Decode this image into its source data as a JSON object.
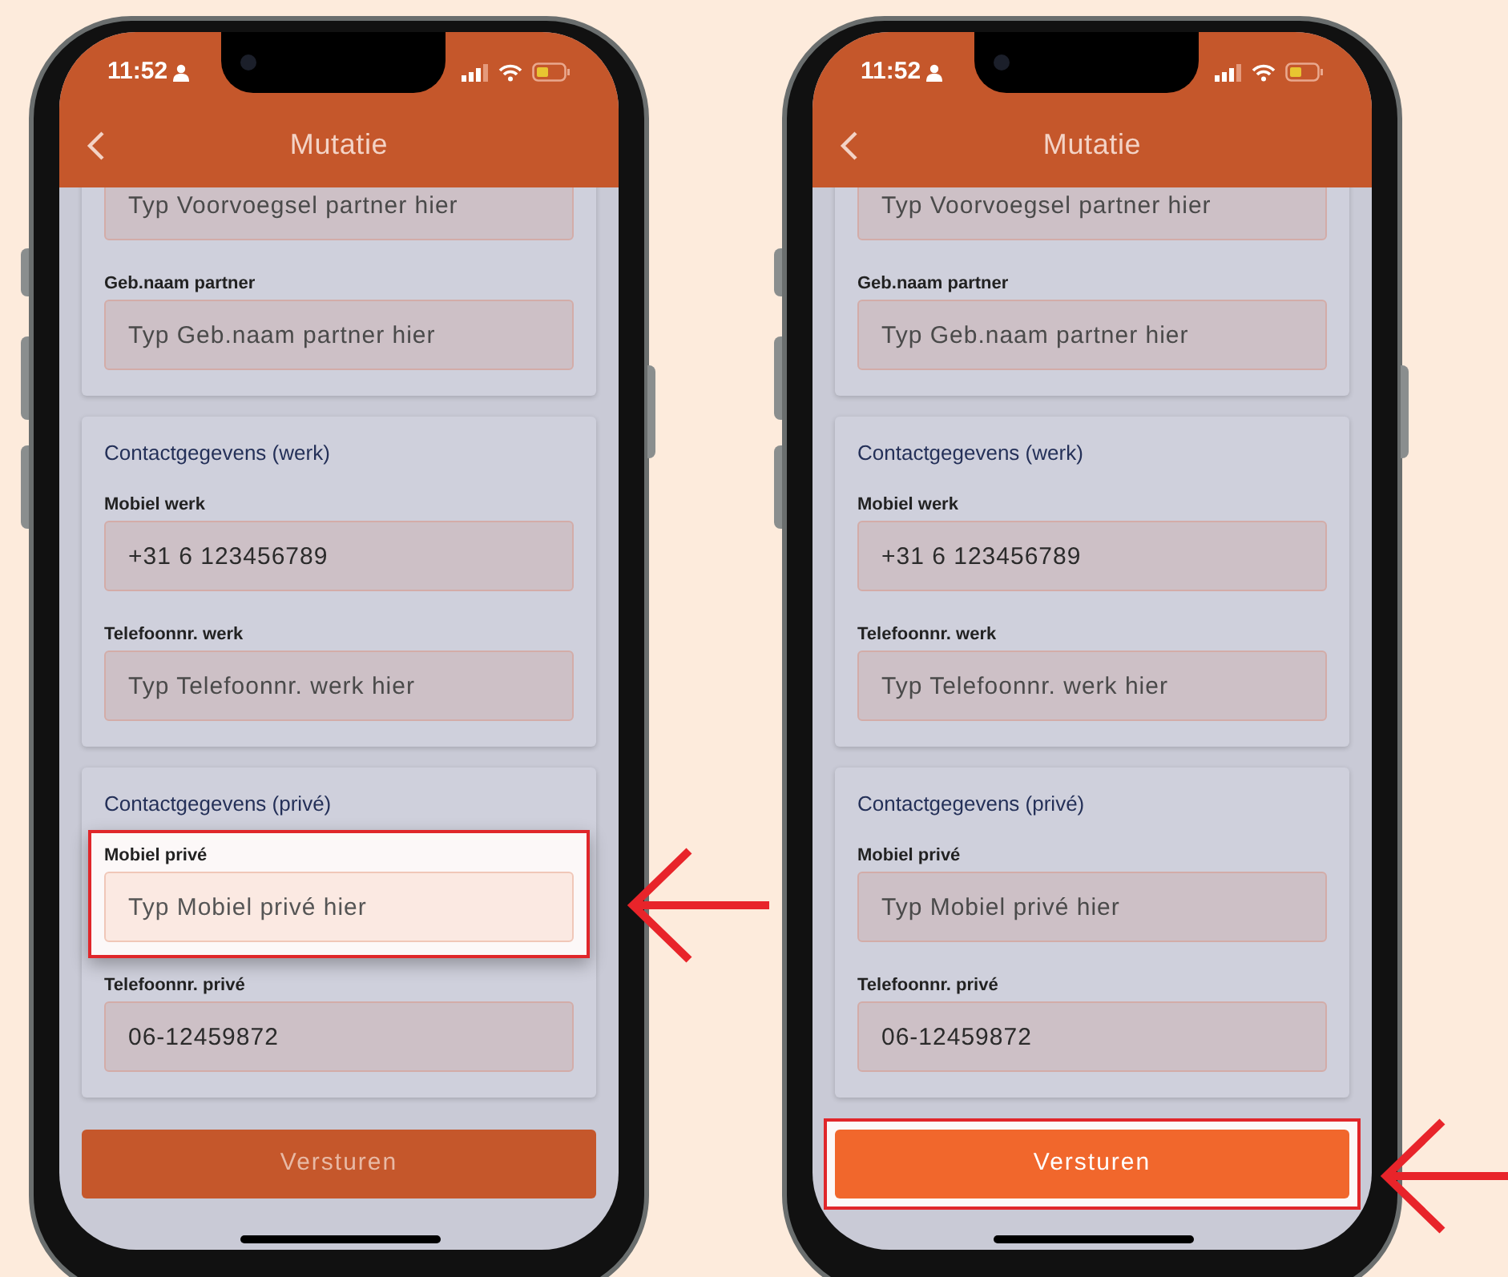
{
  "phones": [
    {
      "status_bar": {
        "time": "11:52"
      },
      "header": {
        "title": "Mutatie"
      },
      "cards": [
        {
          "fields": [
            {
              "placeholder": "Typ Voorvoegsel partner hier",
              "highlighted": false
            },
            {
              "label": "Geb.naam partner",
              "placeholder": "Typ Geb.naam partner hier",
              "highlighted": false
            }
          ]
        },
        {
          "title": "Contactgegevens (werk)",
          "fields": [
            {
              "label": "Mobiel werk",
              "value": "+31 6 123456789",
              "highlighted": false
            },
            {
              "label": "Telefoonnr. werk",
              "placeholder": "Typ Telefoonnr. werk hier",
              "highlighted": false
            }
          ]
        },
        {
          "title": "Contactgegevens (privé)",
          "fields": [
            {
              "label": "Mobiel privé",
              "placeholder": "Typ Mobiel privé hier",
              "highlighted": true
            },
            {
              "label": "Telefoonnr. privé",
              "value": "06-12459872",
              "highlighted": false
            }
          ]
        }
      ],
      "submit_button": {
        "label": "Versturen",
        "disabled": true,
        "highlighted": false
      }
    },
    {
      "status_bar": {
        "time": "11:52"
      },
      "header": {
        "title": "Mutatie"
      },
      "cards": [
        {
          "fields": [
            {
              "placeholder": "Typ Voorvoegsel partner hier",
              "highlighted": false
            },
            {
              "label": "Geb.naam partner",
              "placeholder": "Typ Geb.naam partner hier",
              "highlighted": false
            }
          ]
        },
        {
          "title": "Contactgegevens (werk)",
          "fields": [
            {
              "label": "Mobiel werk",
              "value": "+31 6 123456789",
              "highlighted": false
            },
            {
              "label": "Telefoonnr. werk",
              "placeholder": "Typ Telefoonnr. werk hier",
              "highlighted": false
            }
          ]
        },
        {
          "title": "Contactgegevens (privé)",
          "fields": [
            {
              "label": "Mobiel privé",
              "placeholder": "Typ Mobiel privé hier",
              "highlighted": false
            },
            {
              "label": "Telefoonnr. privé",
              "value": "06-12459872",
              "highlighted": false
            }
          ]
        }
      ],
      "submit_button": {
        "label": "Versturen",
        "disabled": false,
        "highlighted": true
      }
    }
  ]
}
